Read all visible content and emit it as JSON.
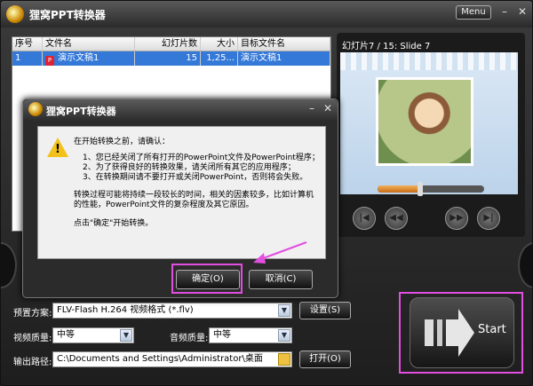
{
  "window": {
    "title": "狸窝PPT转换器",
    "menu_label": "Menu"
  },
  "file_table": {
    "columns": [
      "序号",
      "文件名",
      "幻灯片数",
      "大小",
      "目标文件名"
    ],
    "rows": [
      {
        "index": "1",
        "name": "演示文稿1",
        "slides": "15",
        "size": "1,25...",
        "target": "演示文稿1"
      }
    ]
  },
  "preview": {
    "slide_label": "幻灯片7 / 15: Slide 7",
    "progress": 0.4
  },
  "dialog": {
    "title": "狸窝PPT转换器",
    "intro": "在开始转换之前，请确认：",
    "item1": "1、您已经关闭了所有打开的PowerPoint文件及PowerPoint程序；",
    "item2": "2、为了获得良好的转换效果，请关闭所有其它的应用程序；",
    "item3": "3、在转换期间请不要打开或关闭PowerPoint，否则将会失败。",
    "note1": "转换过程可能将持续一段较长的时间，相关的因素较多，比如计算机",
    "note2": "的性能，PowerPoint文件的复杂程度及其它原因。",
    "prompt": "点击\"确定\"开始转换。",
    "ok_label": "确定(O)",
    "cancel_label": "取消(C)"
  },
  "settings": {
    "preset_label": "预置方案:",
    "preset_value": "FLV-Flash H.264 视频格式 (*.flv)",
    "settings_button": "设置(S)",
    "video_quality_label": "视频质量:",
    "video_quality_value": "中等",
    "audio_quality_label": "音频质量:",
    "audio_quality_value": "中等",
    "output_path_label": "输出路径:",
    "output_path_value": "C:\\Documents and Settings\\Administrator\\桌面",
    "open_button": "打开(O)",
    "start_label": "Start"
  },
  "colors": {
    "highlight": "#e24ee0",
    "selection": "#3478d8"
  }
}
